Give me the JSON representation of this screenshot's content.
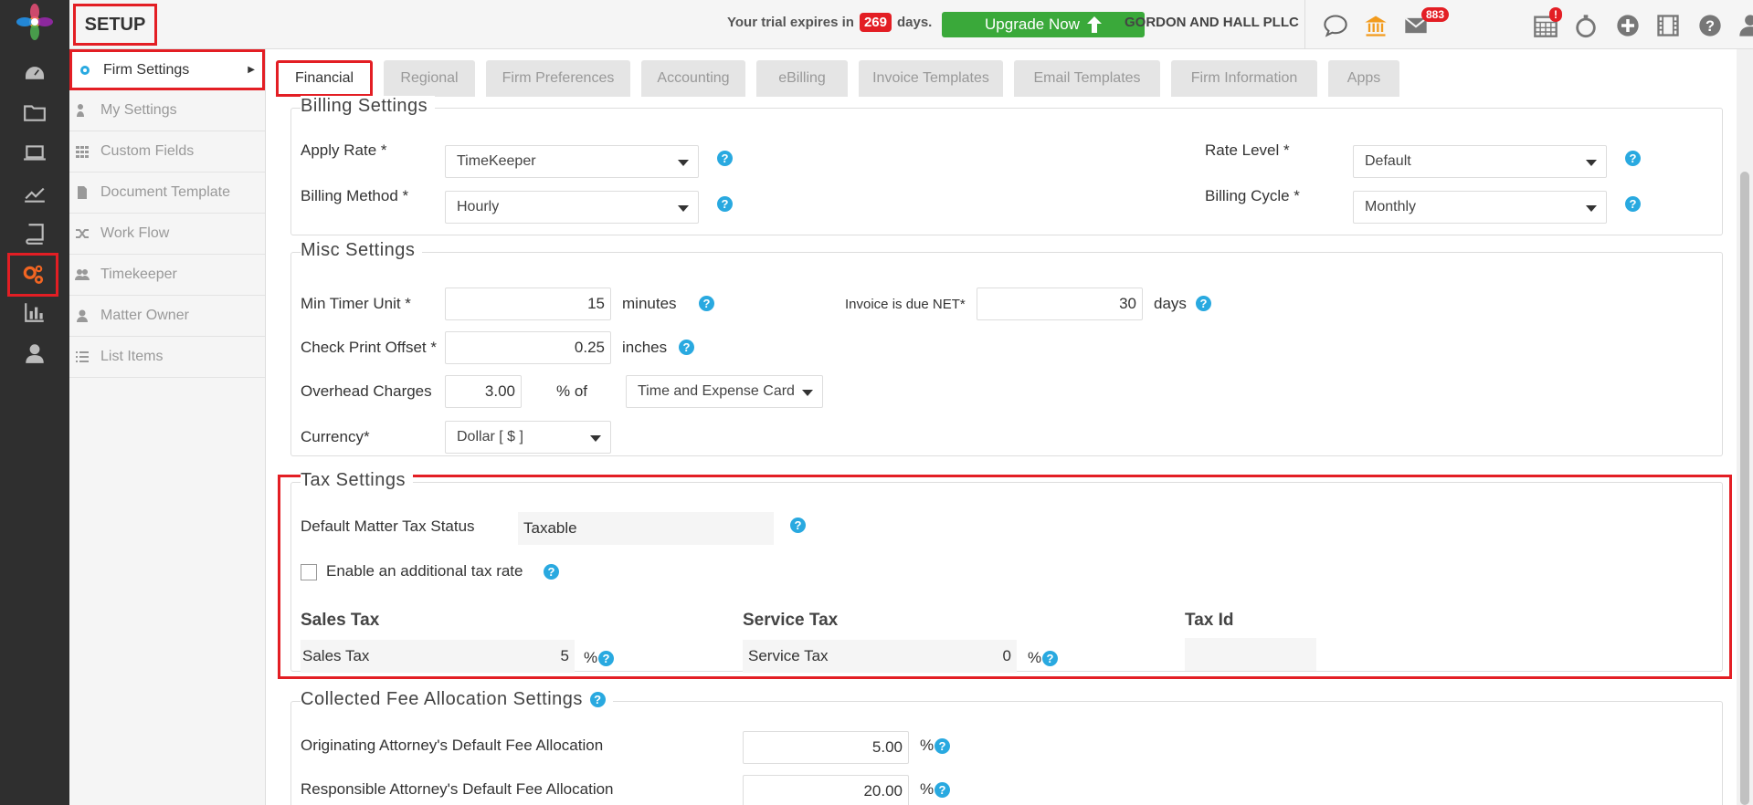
{
  "header": {
    "title": "SETUP",
    "trial_prefix": "Your trial expires in",
    "trial_days": "269",
    "trial_suffix": "days.",
    "upgrade_label": "Upgrade Now",
    "firm_name": "GORDON AND HALL PLLC",
    "mail_badge": "883",
    "calendar_badge": "!"
  },
  "subnav": {
    "items": [
      {
        "label": "Firm Settings",
        "icon": "gear-icon"
      },
      {
        "label": "My Settings",
        "icon": "person-gear-icon"
      },
      {
        "label": "Custom Fields",
        "icon": "grid-icon"
      },
      {
        "label": "Document Template",
        "icon": "document-icon"
      },
      {
        "label": "Work Flow",
        "icon": "shuffle-icon"
      },
      {
        "label": "Timekeeper",
        "icon": "users-icon"
      },
      {
        "label": "Matter Owner",
        "icon": "user-icon"
      },
      {
        "label": "List Items",
        "icon": "list-icon"
      }
    ]
  },
  "tabs": [
    {
      "label": "Financial",
      "active": true
    },
    {
      "label": "Regional"
    },
    {
      "label": "Firm Preferences"
    },
    {
      "label": "Accounting"
    },
    {
      "label": "eBilling"
    },
    {
      "label": "Invoice Templates"
    },
    {
      "label": "Email Templates"
    },
    {
      "label": "Firm Information"
    },
    {
      "label": "Apps"
    }
  ],
  "billing": {
    "legend": "Billing Settings",
    "apply_rate_label": "Apply Rate *",
    "apply_rate_value": "TimeKeeper",
    "billing_method_label": "Billing Method *",
    "billing_method_value": "Hourly",
    "rate_level_label": "Rate Level *",
    "rate_level_value": "Default",
    "billing_cycle_label": "Billing Cycle *",
    "billing_cycle_value": "Monthly"
  },
  "misc": {
    "legend": "Misc Settings",
    "min_timer_label": "Min Timer Unit *",
    "min_timer_value": "15",
    "min_timer_unit": "minutes",
    "invoice_due_label": "Invoice is due NET*",
    "invoice_due_value": "30",
    "invoice_due_unit": "days",
    "check_offset_label": "Check Print Offset *",
    "check_offset_value": "0.25",
    "check_offset_unit": "inches",
    "overhead_label": "Overhead Charges",
    "overhead_value": "3.00",
    "overhead_unit": "% of",
    "overhead_basis": "Time and Expense Card",
    "currency_label": "Currency*",
    "currency_value": "Dollar [ $ ]"
  },
  "tax": {
    "legend": "Tax Settings",
    "default_status_label": "Default Matter Tax Status",
    "default_status_value": "Taxable",
    "additional_rate_label": "Enable an additional tax rate",
    "sales_tax_heading": "Sales Tax",
    "sales_tax_name": "Sales Tax",
    "sales_tax_value": "5",
    "service_tax_heading": "Service Tax",
    "service_tax_name": "Service Tax",
    "service_tax_value": "0",
    "tax_id_heading": "Tax Id",
    "percent": "%"
  },
  "collected": {
    "legend": "Collected Fee Allocation Settings",
    "originating_label": "Originating Attorney's Default Fee Allocation",
    "originating_value": "5.00",
    "responsible_label": "Responsible Attorney's Default Fee Allocation",
    "responsible_value": "20.00",
    "percent": "%"
  },
  "help_glyph": "?",
  "colors": {
    "accent_red": "#e31e24",
    "upgrade_green": "#3aa93a",
    "help_blue": "#29a9e0",
    "rail_dark": "#2f2f2f"
  }
}
